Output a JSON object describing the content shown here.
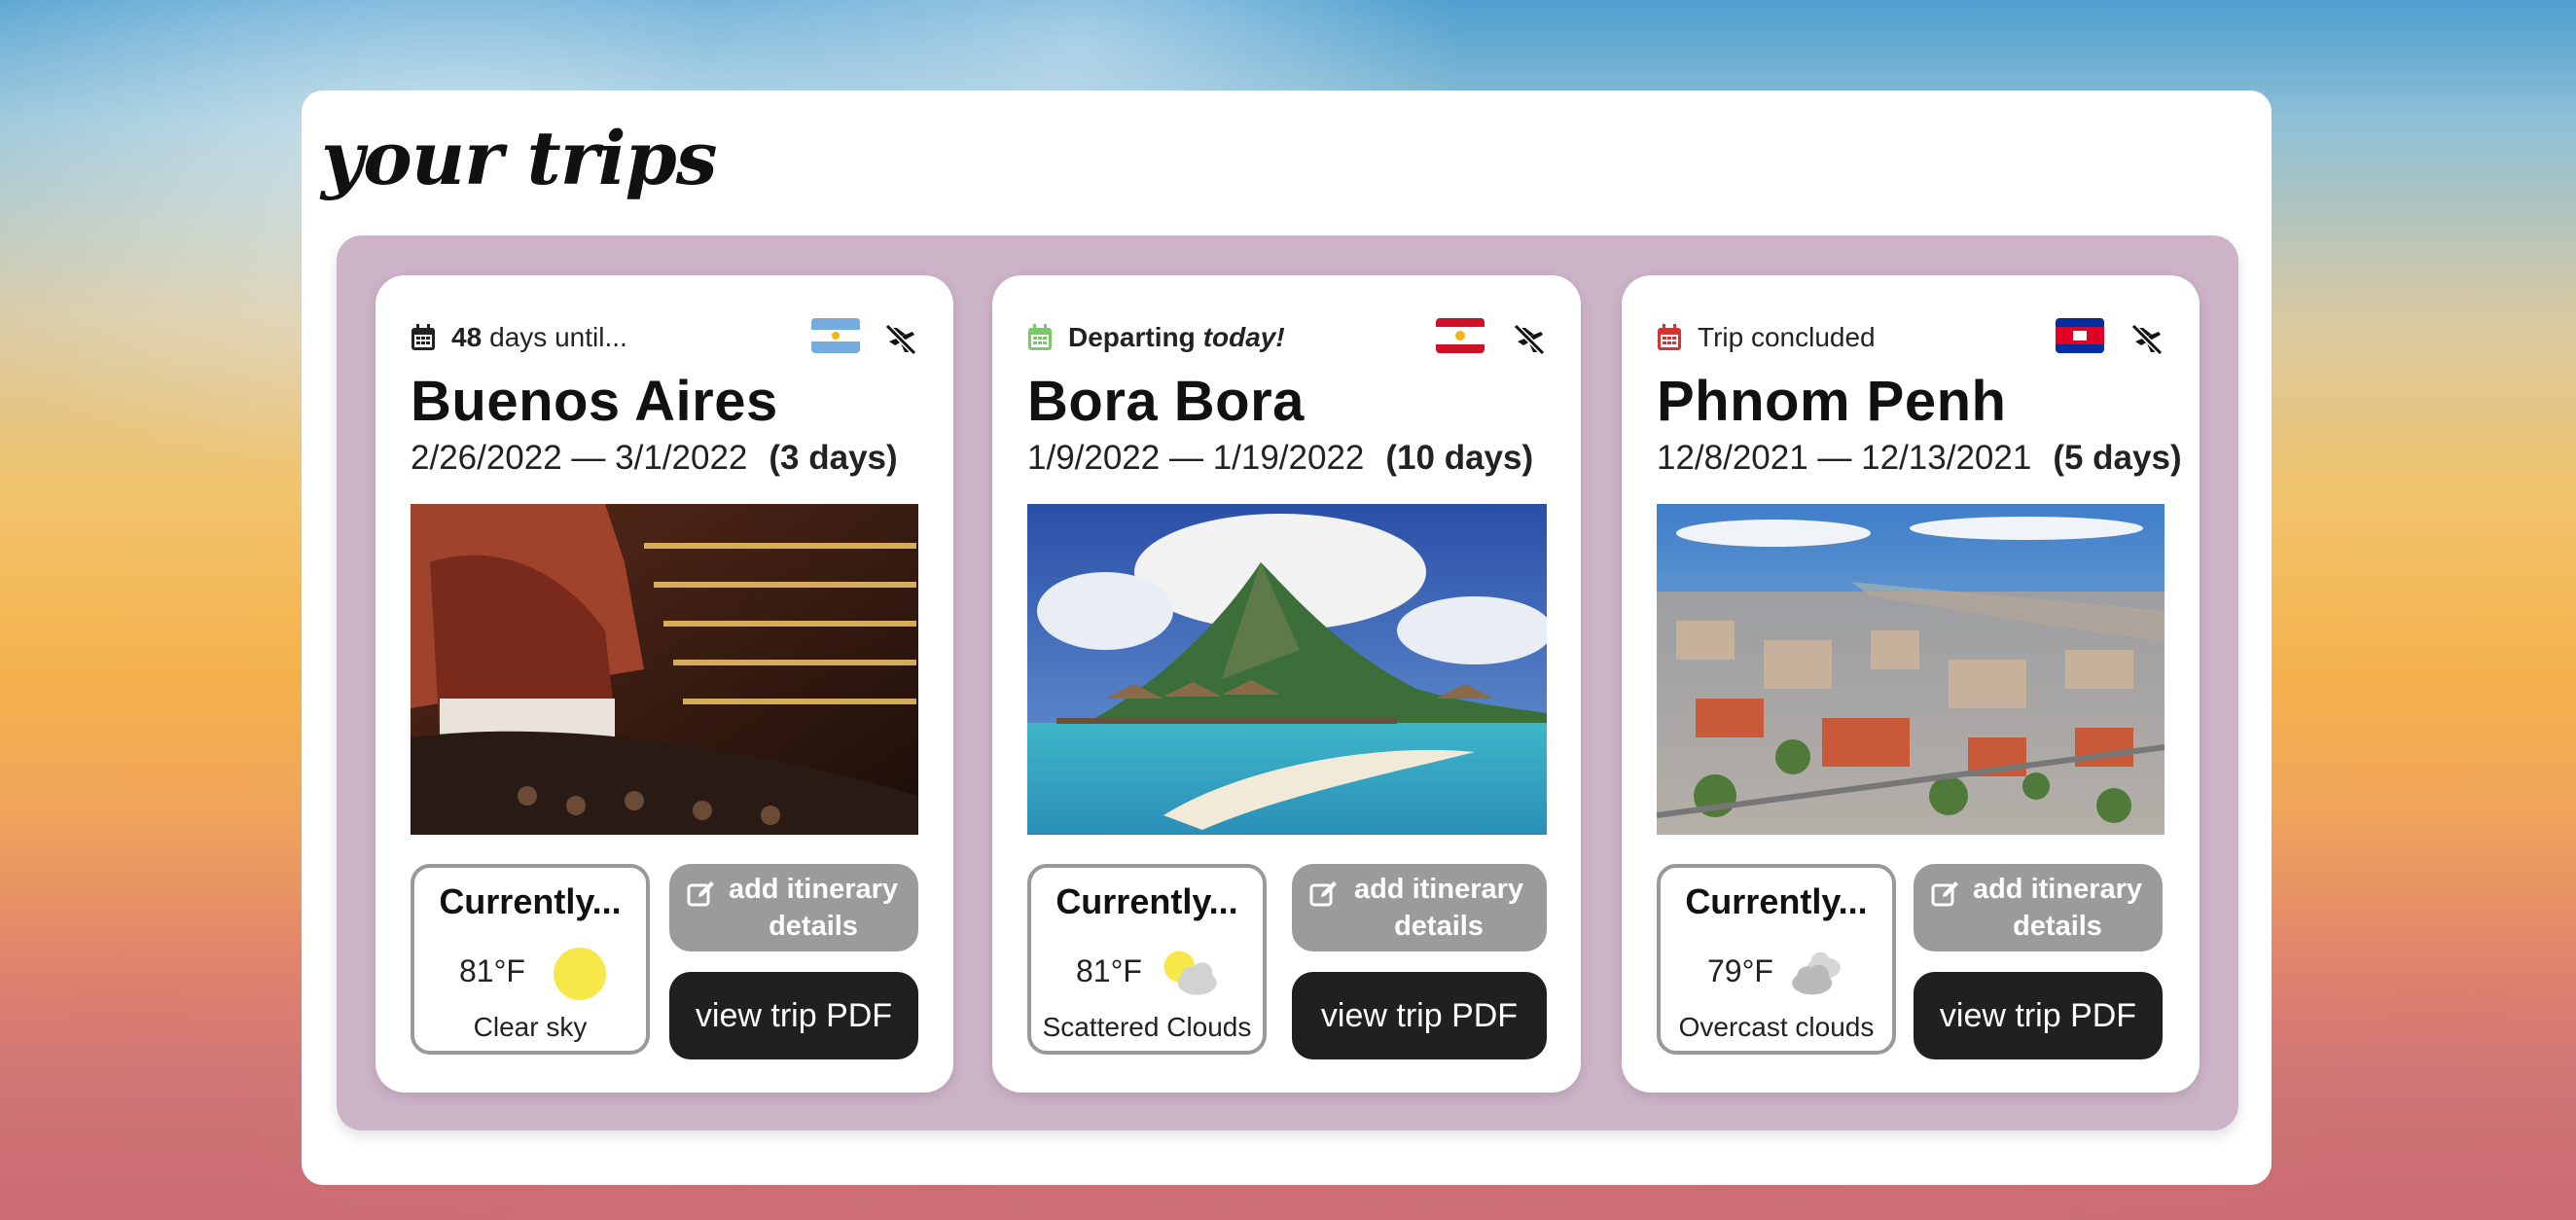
{
  "page": {
    "heading": "your trips"
  },
  "trips": [
    {
      "status": {
        "count": "48",
        "text": "days until..."
      },
      "city": "Buenos Aires",
      "date_range": "2/26/2022 — 3/1/2022",
      "duration": "(3 days)",
      "flag": "Argentina",
      "weather": {
        "header": "Currently...",
        "temp": "81°F",
        "desc": "Clear sky",
        "icon": "sun-icon"
      },
      "edit_label": "add itinerary details",
      "pdf_label": "view trip PDF",
      "calendar_color": "#222222"
    },
    {
      "status": {
        "text": "Departing",
        "emph": "today!"
      },
      "city": "Bora Bora",
      "date_range": "1/9/2022 — 1/19/2022",
      "duration": "(10 days)",
      "flag": "French Polynesia",
      "weather": {
        "header": "Currently...",
        "temp": "81°F",
        "desc": "Scattered Clouds",
        "icon": "partly-cloudy-icon"
      },
      "edit_label": "add itinerary details",
      "pdf_label": "view trip PDF",
      "calendar_color": "#7cc96a"
    },
    {
      "status": {
        "text": "Trip concluded"
      },
      "city": "Phnom Penh",
      "date_range": "12/8/2021 — 12/13/2021",
      "duration": "(5 days)",
      "flag": "Cambodia",
      "weather": {
        "header": "Currently...",
        "temp": "79°F",
        "desc": "Overcast clouds",
        "icon": "clouds-icon"
      },
      "edit_label": "add itinerary details",
      "pdf_label": "view trip PDF",
      "calendar_color": "#d9322f"
    }
  ],
  "colors": {
    "tray": "#cdb3c8",
    "edit_button": "#9b9b9b",
    "pdf_button": "#202020",
    "sun": "#f7e84a"
  }
}
